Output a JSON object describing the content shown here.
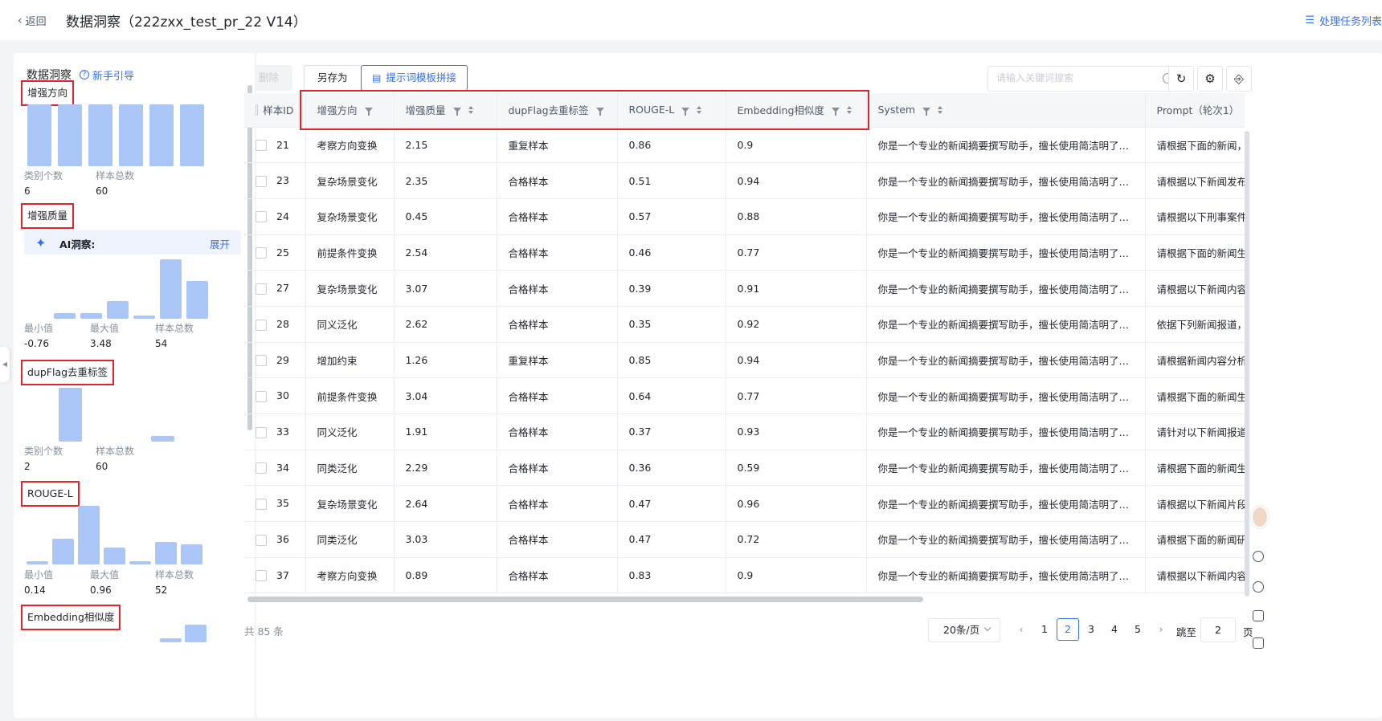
{
  "header": {
    "back_label": "返回",
    "title": "数据洞察（222zxx_test_pr_22 V14）",
    "task_list_label": "处理任务列表"
  },
  "left_panel": {
    "title": "数据洞察",
    "guide_label": "新手引导",
    "sections": {
      "direction": {
        "label": "增强方向",
        "stat1_key": "类别个数",
        "stat1_val": "6",
        "stat2_key": "样本总数",
        "stat2_val": "60"
      },
      "quality": {
        "label": "增强质量",
        "ai_label": "AI洞察:",
        "ai_expand": "展开",
        "stat1_key": "最小值",
        "stat1_val": "-0.76",
        "stat2_key": "最大值",
        "stat2_val": "3.48",
        "stat3_key": "样本总数",
        "stat3_val": "54"
      },
      "dupflag": {
        "label": "dupFlag去重标签",
        "stat1_key": "类别个数",
        "stat1_val": "2",
        "stat2_key": "样本总数",
        "stat2_val": "60"
      },
      "rouge": {
        "label": "ROUGE-L",
        "stat1_key": "最小值",
        "stat1_val": "0.14",
        "stat2_key": "最大值",
        "stat2_val": "0.96",
        "stat3_key": "样本总数",
        "stat3_val": "52"
      },
      "embedding": {
        "label": "Embedding相似度"
      }
    },
    "histograms": {
      "direction": [
        10,
        10,
        10,
        10,
        10,
        10
      ],
      "quality": [
        1,
        1,
        3,
        0.5,
        10,
        6.3
      ],
      "dupflag": [
        10,
        1.1
      ],
      "rouge": [
        0.6,
        4.4,
        10,
        2.9,
        0.6,
        3.9,
        3.4
      ],
      "embedding": [
        0.5,
        2.4
      ]
    }
  },
  "toolbar": {
    "delete_label": "删除",
    "save_as_label": "另存为",
    "prompt_template_label": "提示词模板拼接",
    "search_placeholder": "请输入关键词搜索"
  },
  "table": {
    "columns": [
      "样本ID",
      "增强方向",
      "增强质量",
      "dupFlag去重标签",
      "ROUGE-L",
      "Embedding相似度",
      "System",
      "Prompt（轮次1）"
    ],
    "rows": [
      [
        "21",
        "考察方向变换",
        "2.15",
        "重复样本",
        "0.86",
        "0.9",
        "你是一个专业的新闻摘要撰写助手，擅长使用简洁明了的语言来...",
        "请根据下面的新闻，分"
      ],
      [
        "23",
        "复杂场景变化",
        "2.35",
        "合格样本",
        "0.51",
        "0.94",
        "你是一个专业的新闻摘要撰写助手，擅长使用简洁明了的语言来...",
        "请根据以下新闻发布会"
      ],
      [
        "24",
        "复杂场景变化",
        "0.45",
        "合格样本",
        "0.57",
        "0.88",
        "你是一个专业的新闻摘要撰写助手，擅长使用简洁明了的语言来...",
        "请根据以下刑事案件法"
      ],
      [
        "25",
        "前提条件变换",
        "2.54",
        "合格样本",
        "0.46",
        "0.77",
        "你是一个专业的新闻摘要撰写助手，擅长使用简洁明了的语言来...",
        "请根据下面的新闻生成"
      ],
      [
        "27",
        "复杂场景变化",
        "3.07",
        "合格样本",
        "0.39",
        "0.91",
        "你是一个专业的新闻摘要撰写助手，擅长使用简洁明了的语言来...",
        "请根据以下新闻内容生"
      ],
      [
        "28",
        "同义泛化",
        "2.62",
        "合格样本",
        "0.35",
        "0.92",
        "你是一个专业的新闻摘要撰写助手，擅长使用简洁明了的语言来...",
        "依据下列新闻报道，撰"
      ],
      [
        "29",
        "增加约束",
        "1.26",
        "重复样本",
        "0.85",
        "0.94",
        "你是一个专业的新闻摘要撰写助手，擅长使用简洁明了的语言来...",
        "请根据新闻内容分析并"
      ],
      [
        "30",
        "前提条件变换",
        "3.04",
        "合格样本",
        "0.64",
        "0.77",
        "你是一个专业的新闻摘要撰写助手，擅长使用简洁明了的语言来...",
        "请根据下面的新闻生成"
      ],
      [
        "33",
        "同义泛化",
        "1.91",
        "合格样本",
        "0.37",
        "0.93",
        "你是一个专业的新闻摘要撰写助手，擅长使用简洁明了的语言来...",
        "请针对以下新闻报道撰"
      ],
      [
        "34",
        "同类泛化",
        "2.29",
        "合格样本",
        "0.36",
        "0.59",
        "你是一个专业的新闻摘要撰写助手，擅长使用简洁明了的语言来...",
        "请根据下面的新闻生成"
      ],
      [
        "35",
        "复杂场景变化",
        "2.64",
        "合格样本",
        "0.47",
        "0.96",
        "你是一个专业的新闻摘要撰写助手，擅长使用简洁明了的语言来...",
        "请根据以下新闻片段撰"
      ],
      [
        "36",
        "同类泛化",
        "3.03",
        "合格样本",
        "0.47",
        "0.72",
        "你是一个专业的新闻摘要撰写助手，擅长使用简洁明了的语言来...",
        "请根据下面的新闻研究"
      ],
      [
        "37",
        "考察方向变换",
        "0.89",
        "合格样本",
        "0.83",
        "0.9",
        "你是一个专业的新闻摘要撰写助手，擅长使用简洁明了的语言来...",
        "请根据以下新闻内容，"
      ]
    ]
  },
  "pagination": {
    "total_label": "共 85 条",
    "page_size_label": "20条/页",
    "pages": [
      "1",
      "2",
      "3",
      "4",
      "5"
    ],
    "current_page": "2",
    "jump_label": "跳至",
    "jump_value": "2",
    "jump_suffix": "页"
  },
  "colors": {
    "accent": "#3370ff",
    "highlight": "#e3242b",
    "bar": "#a9c6f7"
  }
}
